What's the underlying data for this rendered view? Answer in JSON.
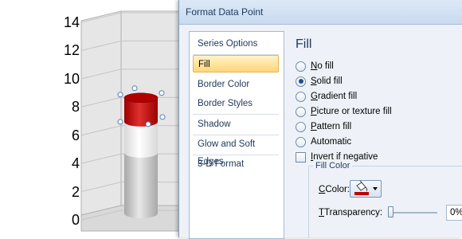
{
  "chart": {
    "y_ticks": [
      "14",
      "12",
      "10",
      "8",
      "6",
      "4",
      "2",
      "0"
    ]
  },
  "chart_data": {
    "type": "bar",
    "categories": [
      ""
    ],
    "series": [
      {
        "values": [
          4.3
        ],
        "color": "#cfcfcf"
      },
      {
        "values": [
          2.2
        ],
        "color": "#f2f2f2"
      },
      {
        "values": [
          1.7
        ],
        "color": "#c00000"
      }
    ],
    "stacked": true,
    "ylim": [
      0,
      14
    ],
    "yticks": [
      0,
      2,
      4,
      6,
      8,
      10,
      12,
      14
    ],
    "three_d": true,
    "bar_shape": "cylinder",
    "selected_segment": 3,
    "title": "",
    "xlabel": "",
    "ylabel": ""
  },
  "dialog": {
    "title": "Format Data Point",
    "nav": [
      {
        "label": "Series Options",
        "selected": false
      },
      {
        "label": "Fill",
        "selected": true
      },
      {
        "label": "Border Color",
        "selected": false
      },
      {
        "label": "Border Styles",
        "selected": false
      },
      {
        "label": "Shadow",
        "selected": false
      },
      {
        "label": "Glow and Soft Edges",
        "selected": false
      },
      {
        "label": "3-D Format",
        "selected": false
      }
    ],
    "panel": {
      "heading": "Fill",
      "options": [
        {
          "key": "N",
          "rest": "o fill",
          "checked": false
        },
        {
          "key": "S",
          "rest": "olid fill",
          "checked": true
        },
        {
          "key": "G",
          "rest": "radient fill",
          "checked": false
        },
        {
          "key": "P",
          "rest": "icture or texture fill",
          "checked": false
        },
        {
          "key": "P",
          "rest": "attern fill",
          "checked": false
        },
        {
          "key": "",
          "rest": "Automatic",
          "checked": false
        }
      ],
      "invert": {
        "key": "I",
        "rest": "nvert if negative",
        "checked": false
      },
      "fill_color_group": "Fill Color",
      "color_label": "Color:",
      "color_swatch": "#c00000",
      "transparency_label": "Transparency:",
      "transparency_value": "0%",
      "transparency_level": 0
    }
  }
}
